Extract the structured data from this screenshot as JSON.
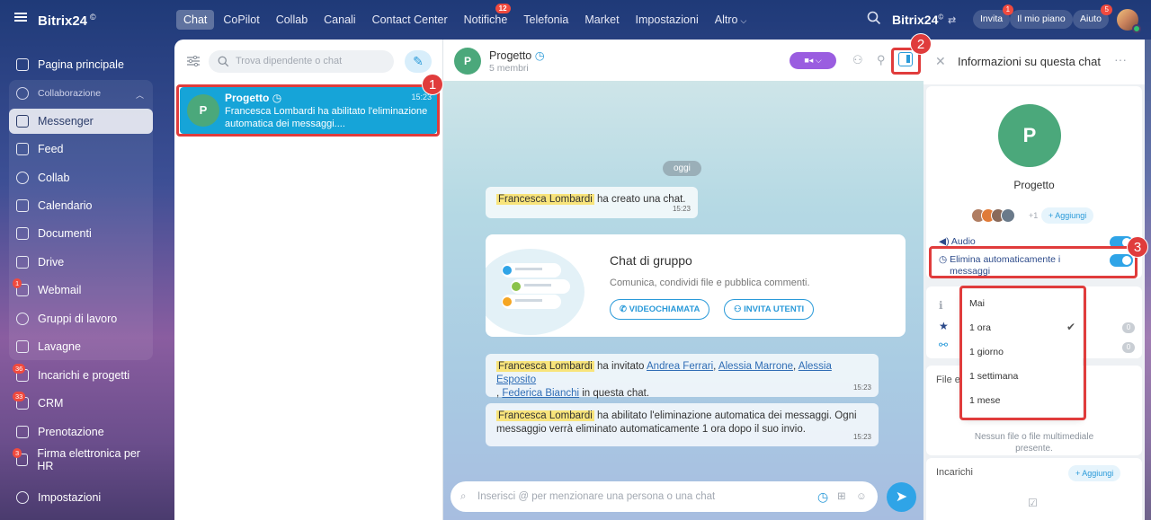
{
  "topbar": {
    "logo": "Bitrix24",
    "logo_mark": "©",
    "nav": [
      {
        "label": "Chat",
        "active": true
      },
      {
        "label": "CoPilot"
      },
      {
        "label": "Collab"
      },
      {
        "label": "Canali"
      },
      {
        "label": "Contact Center"
      },
      {
        "label": "Notifiche",
        "badge": "12"
      },
      {
        "label": "Telefonia"
      },
      {
        "label": "Market"
      },
      {
        "label": "Impostazioni"
      },
      {
        "label": "Altro"
      }
    ],
    "brand": "Bitrix24",
    "brand_mark": "©",
    "invite": "Invita",
    "invite_badge": "1",
    "plan": "Il mio piano",
    "help": "Aiuto",
    "help_badge": "5"
  },
  "sidebar": {
    "items": [
      {
        "label": "Pagina principale"
      },
      {
        "label": "Collaborazione"
      },
      {
        "label": "Messenger"
      },
      {
        "label": "Feed"
      },
      {
        "label": "Collab"
      },
      {
        "label": "Calendario"
      },
      {
        "label": "Documenti"
      },
      {
        "label": "Drive"
      },
      {
        "label": "Webmail",
        "badge": "1"
      },
      {
        "label": "Gruppi di lavoro"
      },
      {
        "label": "Lavagne"
      },
      {
        "label": "Incarichi e progetti",
        "badge": "36"
      },
      {
        "label": "CRM",
        "badge": "33"
      },
      {
        "label": "Prenotazione"
      },
      {
        "label": "Firma elettronica per HR",
        "badge": "3"
      },
      {
        "label": "Impostazioni"
      }
    ]
  },
  "chatlist": {
    "search_placeholder": "Trova dipendente o chat",
    "items": [
      {
        "avatar": "P",
        "title": "Progetto",
        "time": "15:23",
        "message": "Francesca Lombardi ha abilitato l'eliminazione automatica dei messaggi...."
      }
    ]
  },
  "chat": {
    "avatar": "P",
    "title": "Progetto",
    "subtitle": "5 membri",
    "date_label": "oggi",
    "messages": [
      {
        "author": "Francesca Lombardi",
        "text": " ha creato una chat.",
        "time": "15:23"
      },
      {
        "author": "Francesca Lombardi",
        "text_before": " ha invitato ",
        "users": [
          "Andrea Ferrari",
          "Alessia Marrone",
          "Alessia Esposito",
          "Federica Bianchi"
        ],
        "text_after": " in questa chat.",
        "time": "15:23"
      },
      {
        "author": "Francesca Lombardi",
        "text": " ha abilitato l'eliminazione automatica dei messaggi. Ogni messaggio verrà eliminato automaticamente 1 ora dopo il suo invio.",
        "time": "15:23"
      }
    ],
    "group_card": {
      "title": "Chat di gruppo",
      "description": "Comunica, condividi file e pubblica commenti.",
      "video_button": "VIDEOCHIAMATA",
      "invite_button": "INVITA UTENTI"
    },
    "input_placeholder": "Inserisci @ per menzionare una persona o una chat"
  },
  "info": {
    "title": "Informazioni su questa chat",
    "avatar": "P",
    "name": "Progetto",
    "more_members": "+1",
    "add_label": "+ Aggiungi",
    "audio_label": "Audio",
    "autodelete_label": "Elimina automaticamente i messaggi",
    "counts": [
      "0",
      "0"
    ],
    "files_label": "File e",
    "no_files": "Nessun file o file multimediale presente.",
    "tasks_label": "Incarichi",
    "tasks_add": "+ Aggiungi"
  },
  "dropdown": {
    "options": [
      "Mai",
      "1 ora",
      "1 giorno",
      "1 settimana",
      "1 mese"
    ],
    "selected": "1 ora"
  },
  "annotations": [
    "1",
    "2",
    "3"
  ],
  "colors": {
    "accent": "#2fa4e7",
    "selected_chat": "#16a4d8",
    "avatar_green": "#4ba87b",
    "highlight": "#e03c3c",
    "name_highlight": "#f8e47b"
  }
}
